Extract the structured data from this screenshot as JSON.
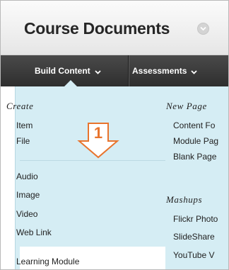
{
  "page": {
    "title": "Course Documents"
  },
  "tabs": [
    {
      "label": "Build Content"
    },
    {
      "label": "Assessments"
    }
  ],
  "menu": {
    "create_heading": "Create",
    "create_items": [
      "Item",
      "File"
    ],
    "media_items": [
      "Audio",
      "Image",
      "Video",
      "Web Link"
    ],
    "highlighted_item": "Learning Module",
    "new_page_heading": "New Page",
    "new_page_items": [
      "Content Fo",
      "Module Pag",
      "Blank Page"
    ],
    "mashups_heading": "Mashups",
    "mashups_items": [
      "Flickr Photo",
      "SlideShare",
      "YouTube V"
    ]
  },
  "callout": {
    "number": "1",
    "color": "#e8742d"
  },
  "colors": {
    "menu_background": "#d5edf4",
    "tab_bar": "#3a3a3a",
    "callout_orange": "#e8742d"
  },
  "icons": {
    "title_menu": "chevron-down-circle-icon",
    "tab_dropdown": "chevron-down-icon",
    "callout_arrow": "down-arrow-icon"
  }
}
